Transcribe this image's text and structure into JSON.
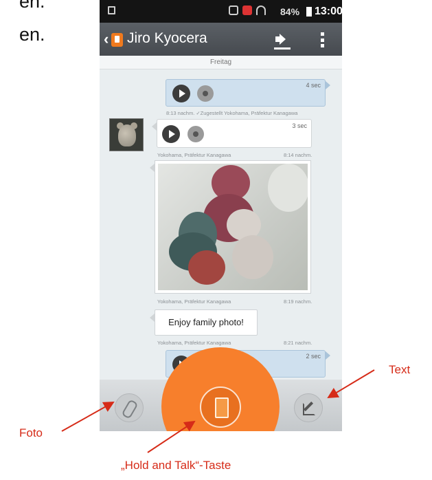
{
  "slide": {
    "top_line_1": "en.",
    "top_line_2": "en."
  },
  "status_bar": {
    "battery": "84%",
    "time": "13:00"
  },
  "action_bar": {
    "contact_name": "Jiro Kyocera"
  },
  "chat": {
    "date_header": "Freitag",
    "messages": [
      {
        "type": "voice",
        "direction": "sent",
        "duration": "4 sec",
        "meta": "8:13 nachm.  ✓Zugestellt  Yokohama, Präfektur Kanagawa"
      },
      {
        "type": "voice",
        "direction": "received",
        "duration": "3 sec",
        "meta_location": "Yokohama, Präfektur Kanagawa",
        "meta_time": "8:14 nachm."
      },
      {
        "type": "photo",
        "direction": "received",
        "meta_location": "Yokohama, Präfektur Kanagawa",
        "meta_time": "8:19 nachm."
      },
      {
        "type": "text",
        "direction": "received",
        "text": "Enjoy family photo!",
        "meta_location": "Yokohama, Präfektur Kanagawa",
        "meta_time": "8:21 nachm."
      },
      {
        "type": "voice",
        "direction": "sent",
        "duration": "2 sec"
      }
    ]
  },
  "annotations": {
    "text": "Text",
    "foto": "Foto",
    "hold_and_talk": "„Hold and Talk“-Taste"
  },
  "colors": {
    "accent_orange": "#f77f2c",
    "annotation_red": "#d62b18",
    "sent_bubble": "#cfe0ee"
  }
}
